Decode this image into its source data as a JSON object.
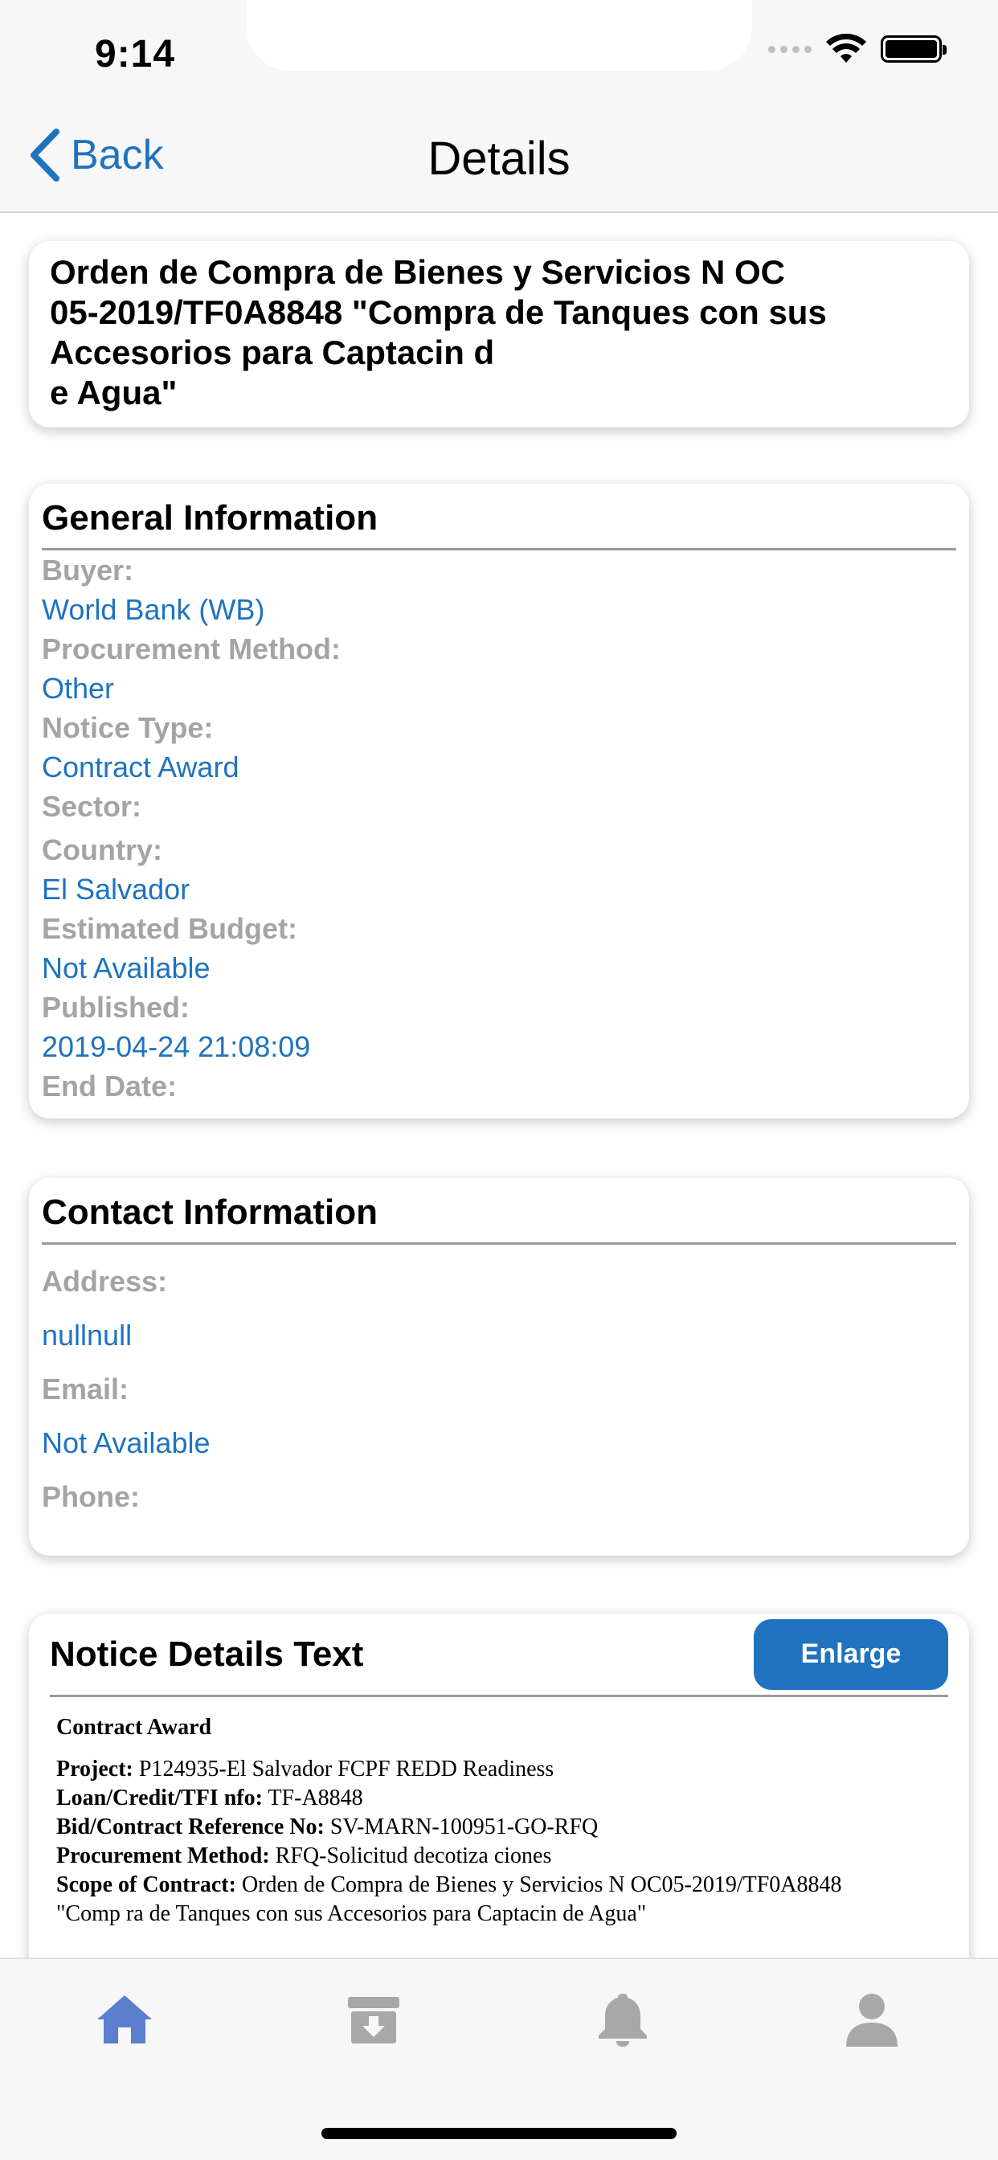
{
  "status_bar": {
    "time": "9:14"
  },
  "nav": {
    "back_label": "Back",
    "title": "Details"
  },
  "notice_title": "Orden de Compra de Bienes y Servicios N OC\n05-2019/TF0A8848 \"Compra de Tanques con sus\nAccesorios para Captacin d\ne Agua\"",
  "general": {
    "title": "General Information",
    "fields": [
      {
        "label": "Buyer:",
        "value": "World Bank (WB)"
      },
      {
        "label": "Procurement Method:",
        "value": "Other"
      },
      {
        "label": "Notice Type:",
        "value": "Contract Award"
      },
      {
        "label": "Sector:",
        "value": ""
      },
      {
        "label": "Country:",
        "value": "El Salvador"
      },
      {
        "label": "Estimated Budget:",
        "value": "Not Available"
      },
      {
        "label": "Published:",
        "value": "2019-04-24 21:08:09"
      },
      {
        "label": "End Date:",
        "value": ""
      }
    ]
  },
  "contact": {
    "title": "Contact Information",
    "fields": [
      {
        "label": "Address:",
        "value": "nullnull"
      },
      {
        "label": "Email:",
        "value": "Not Available"
      },
      {
        "label": "Phone:",
        "value": ""
      }
    ]
  },
  "notice_details": {
    "title": "Notice Details Text",
    "enlarge_label": "Enlarge",
    "heading": "Contract Award",
    "lines": [
      {
        "label": "Project:",
        "value": "P124935-El Salvador FCPF REDD Readiness"
      },
      {
        "label": "Loan/Credit/TFI nfo:",
        "value": "TF-A8848"
      },
      {
        "label": "Bid/Contract Reference No:",
        "value": "SV-MARN-100951-GO-RFQ"
      },
      {
        "label": "Procurement Method:",
        "value": "RFQ-Solicitud decotiza ciones"
      },
      {
        "label": "Scope of Contract:",
        "value": "Orden de Compra de Bienes y Servicios N OC05-2019/TF0A8848"
      },
      {
        "label": "",
        "value": "\"Comp ra de Tanques con sus Accesorios para Captacin de Agua\""
      }
    ]
  },
  "tabbar": {
    "tabs": [
      {
        "icon": "home-icon",
        "active": true
      },
      {
        "icon": "archive-icon",
        "active": false
      },
      {
        "icon": "bell-icon",
        "active": false
      },
      {
        "icon": "person-icon",
        "active": false
      }
    ]
  },
  "colors": {
    "accent": "#1f73bf",
    "label_gray": "#a4a4a4",
    "tab_active": "#5b7fcf",
    "tab_inactive": "#a8a8a8"
  }
}
